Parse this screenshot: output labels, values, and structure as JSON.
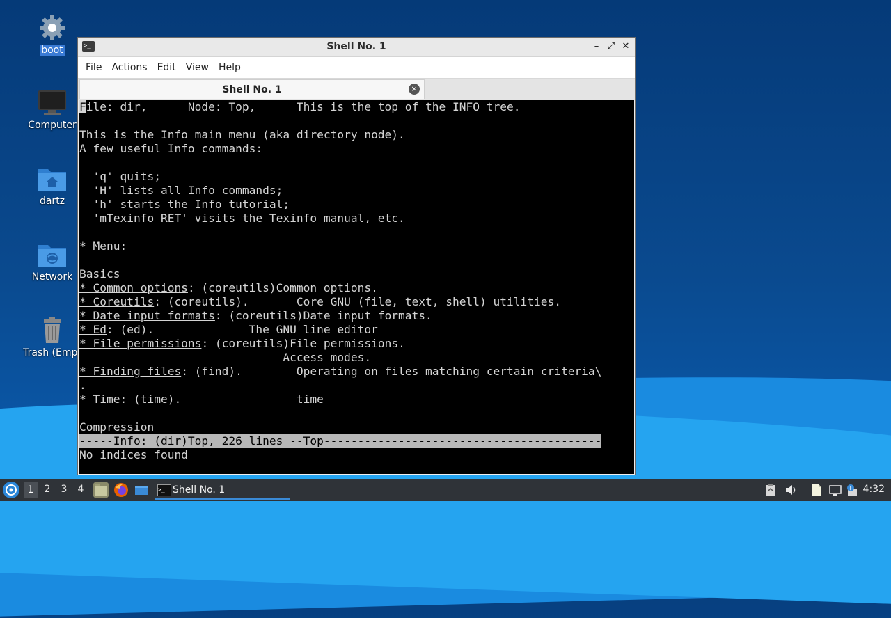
{
  "desktop": {
    "icons": [
      {
        "label": "boot",
        "icon": "gear-icon"
      },
      {
        "label": "Computer",
        "icon": "monitor-icon"
      },
      {
        "label": "dartz",
        "icon": "home-folder-icon"
      },
      {
        "label": "Network",
        "icon": "network-folder-icon"
      },
      {
        "label": "Trash (Empt",
        "icon": "trash-icon"
      }
    ]
  },
  "window": {
    "title": "Shell No. 1",
    "controls": {
      "minimize": "–",
      "maximize": "⤢",
      "close": "✕"
    },
    "menu": [
      "File",
      "Actions",
      "Edit",
      "View",
      "Help"
    ],
    "tab": {
      "label": "Shell No. 1",
      "close": "×"
    }
  },
  "terminal": {
    "line0": {
      "cursor_char": "F",
      "rest": "ile: dir,      Node: Top,      This is the top of the INFO tree."
    },
    "line1": "",
    "line2": "This is the Info main menu (aka directory node).",
    "line3": "A few useful Info commands:",
    "line4": "",
    "line5": "  'q' quits;",
    "line6": "  'H' lists all Info commands;",
    "line7": "  'h' starts the Info tutorial;",
    "line8": "  'mTexinfo RET' visits the Texinfo manual, etc.",
    "line9": "",
    "line10": "* Menu:",
    "line11": "",
    "line12": "Basics",
    "line13": {
      "link": "* Common options",
      "rest": ": (coreutils)Common options."
    },
    "line14": {
      "link": "* Coreutils",
      "rest": ": (coreutils).       Core GNU (file, text, shell) utilities."
    },
    "line15": {
      "link": "* Date input formats",
      "rest": ": (coreutils)Date input formats."
    },
    "line16": {
      "link": "* Ed",
      "rest": ": (ed).              The GNU line editor"
    },
    "line17": {
      "link": "* File permissions",
      "rest": ": (coreutils)File permissions."
    },
    "line18": "                              Access modes.",
    "line19": {
      "link": "* Finding files",
      "rest": ": (find).        Operating on files matching certain criteria\\"
    },
    "line20": ".",
    "line21": {
      "link": "* Time",
      "rest": ": (time).                 time"
    },
    "line22": "",
    "line23": "Compression",
    "status": "-----Info: (dir)Top, 226 lines --Top-----------------------------------------",
    "message": "No indices found"
  },
  "taskbar": {
    "workspaces": [
      "1",
      "2",
      "3",
      "4"
    ],
    "active_workspace": "1",
    "launchers": [
      "file-manager-icon",
      "firefox-icon",
      "desktop-icon"
    ],
    "task_label": "Shell No. 1",
    "tray": [
      "clipboard-icon",
      "volume-icon",
      "notes-icon",
      "display-icon",
      "updates-icon"
    ],
    "clock": "4:32"
  },
  "colors": {
    "desktop_bg": "#0a4a8f",
    "terminal_bg": "#000000",
    "terminal_fg": "#d4d4d4",
    "taskbar_bg": "#2f3338",
    "accent": "#3a8ad6"
  }
}
